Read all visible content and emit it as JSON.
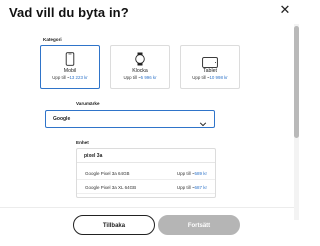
{
  "dialog": {
    "title": "Vad vill du byta in?",
    "close_icon": "close-icon"
  },
  "category": {
    "label": "Kategori",
    "cards": [
      {
        "name": "Mobil",
        "price_prefix": "Upp till",
        "price_amount": "13 223 kr",
        "icon": "mobile-phone-icon",
        "selected": true
      },
      {
        "name": "Klocka",
        "price_prefix": "Upp till",
        "price_amount": "5 996 kr",
        "icon": "smartwatch-icon",
        "selected": false
      },
      {
        "name": "Tablet",
        "price_prefix": "Upp till",
        "price_amount": "10 998 kr",
        "icon": "tablet-icon",
        "selected": false
      }
    ]
  },
  "brand": {
    "label": "Varumärke",
    "value": "Google"
  },
  "device": {
    "label": "Enhet",
    "search_value": "pixel 3a",
    "options": [
      {
        "name": "Google Pixel 3a 64GB",
        "price_prefix": "Upp till",
        "price_amount": "589 kr"
      },
      {
        "name": "Google Pixel 3a XL 64GB",
        "price_prefix": "Upp till",
        "price_amount": "687 kr"
      }
    ]
  },
  "footer": {
    "back_label": "Tillbaka",
    "next_label": "Fortsätt"
  },
  "colors": {
    "accent": "#2f74c9",
    "disabled_button": "#b5b5b5"
  }
}
